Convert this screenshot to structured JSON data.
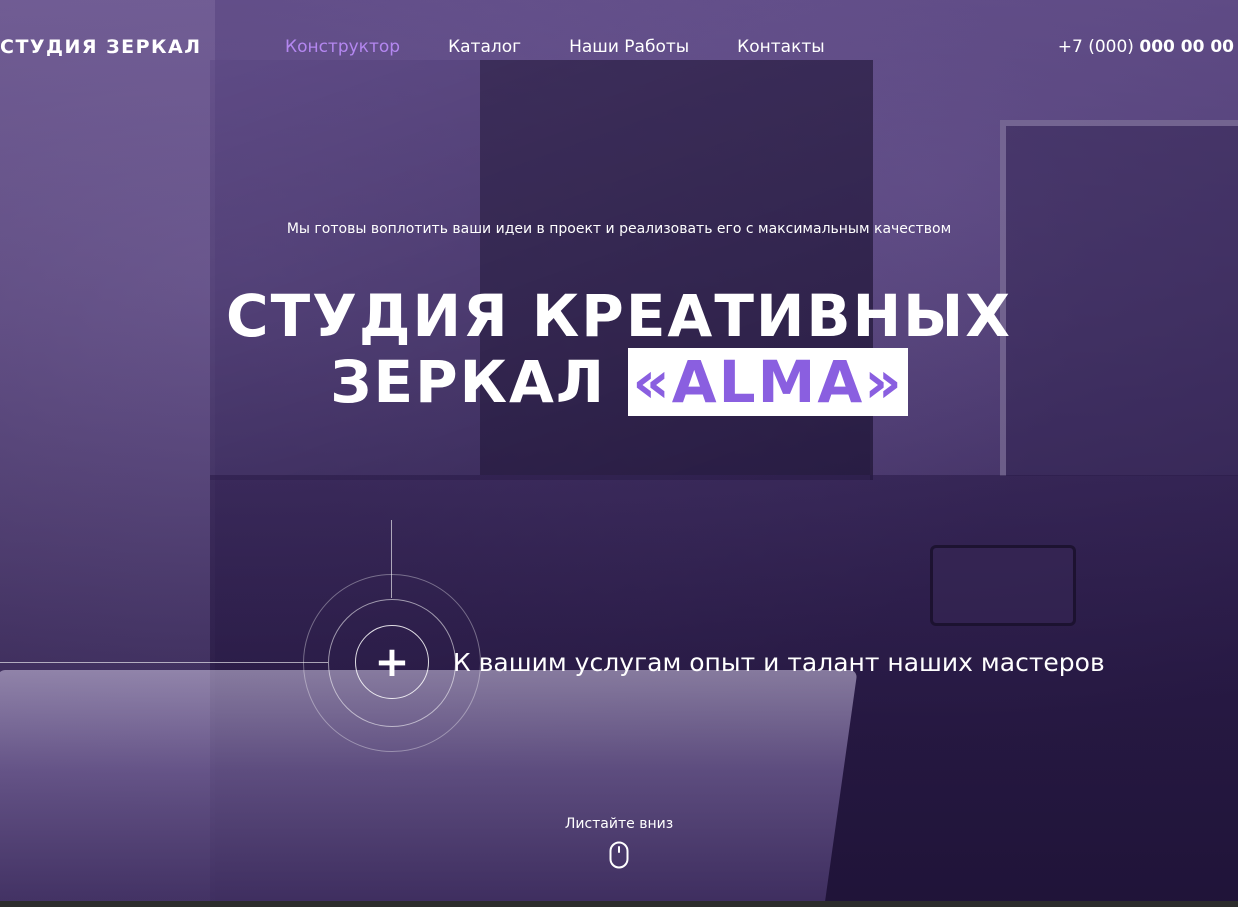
{
  "header": {
    "logo": "СТУДИЯ ЗЕРКАЛ",
    "nav": [
      {
        "label": "Конструктор",
        "active": true
      },
      {
        "label": "Каталог",
        "active": false
      },
      {
        "label": "Наши Работы",
        "active": false
      },
      {
        "label": "Контакты",
        "active": false
      }
    ],
    "phone_prefix": "+7 (000)",
    "phone_number": "000 00 00"
  },
  "hero": {
    "tagline": "Мы готовы воплотить ваши идеи в проект и реализовать его с максимальным качеством",
    "headline_line1": "СТУДИЯ КРЕАТИВНЫХ",
    "headline_line2": "ЗЕРКАЛ",
    "brand": "«ALMA»",
    "plus_symbol": "+",
    "feature_text": "К вашим услугам опыт и талант наших мастеров",
    "scroll_label": "Листайте вниз"
  },
  "colors": {
    "accent": "#b487f0",
    "brand_text": "#8a5fe0",
    "overlay": "#3e2d60"
  },
  "icons": {
    "plus": "plus-icon",
    "scroll": "mouse-icon"
  }
}
